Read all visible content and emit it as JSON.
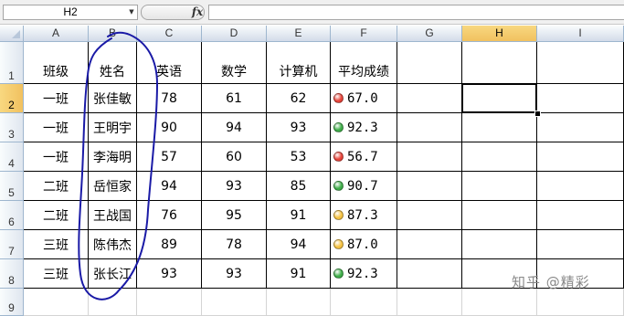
{
  "formula_bar": {
    "name_box": "H2",
    "fx_label": "fx",
    "formula_value": ""
  },
  "columns": [
    "A",
    "B",
    "C",
    "D",
    "E",
    "F",
    "G",
    "H",
    "I"
  ],
  "active_column": "H",
  "rows": [
    "1",
    "2",
    "3",
    "4",
    "5",
    "6",
    "7",
    "8",
    "9"
  ],
  "active_row": "2",
  "table": {
    "headers": [
      "班级",
      "姓名",
      "英语",
      "数学",
      "计算机",
      "平均成绩"
    ],
    "records": [
      {
        "class": "一班",
        "name": "张佳敏",
        "english": "78",
        "math": "61",
        "computer": "62",
        "average": "67.0",
        "indicator": "red"
      },
      {
        "class": "一班",
        "name": "王明宇",
        "english": "90",
        "math": "94",
        "computer": "93",
        "average": "92.3",
        "indicator": "green"
      },
      {
        "class": "一班",
        "name": "李海明",
        "english": "57",
        "math": "60",
        "computer": "53",
        "average": "56.7",
        "indicator": "red"
      },
      {
        "class": "二班",
        "name": "岳恒家",
        "english": "94",
        "math": "93",
        "computer": "85",
        "average": "90.7",
        "indicator": "green"
      },
      {
        "class": "二班",
        "name": "王战国",
        "english": "76",
        "math": "95",
        "computer": "91",
        "average": "87.3",
        "indicator": "yellow"
      },
      {
        "class": "三班",
        "name": "陈伟杰",
        "english": "89",
        "math": "78",
        "computer": "94",
        "average": "87.0",
        "indicator": "yellow"
      },
      {
        "class": "三班",
        "name": "张长江",
        "english": "93",
        "math": "93",
        "computer": "91",
        "average": "92.3",
        "indicator": "green"
      }
    ]
  },
  "indicator_colors": {
    "red": "#e8443a",
    "yellow": "#f5c242",
    "green": "#3fae49"
  },
  "annotation_color": "#1a1aa6",
  "watermark": "知乎 @精彩"
}
